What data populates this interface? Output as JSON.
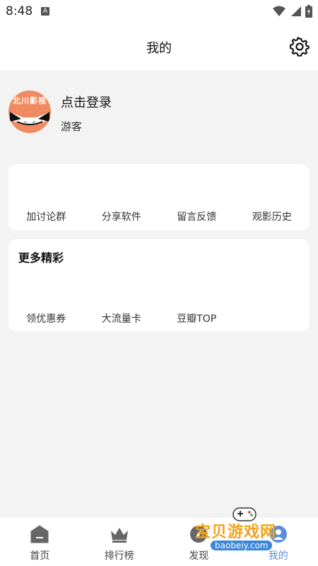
{
  "status_bar": {
    "time": "8:48",
    "a_badge": "A"
  },
  "header": {
    "title": "我的"
  },
  "profile": {
    "avatar_text": "北川影视",
    "login_label": "点击登录",
    "user_type": "游客"
  },
  "quick_actions": [
    {
      "label": "加讨论群"
    },
    {
      "label": "分享软件"
    },
    {
      "label": "留言反馈"
    },
    {
      "label": "观影历史"
    }
  ],
  "more_section": {
    "title": "更多精彩",
    "items": [
      {
        "label": "领优惠券"
      },
      {
        "label": "大流量卡"
      },
      {
        "label": "豆瓣TOP"
      }
    ]
  },
  "tabs": [
    {
      "label": "首页",
      "icon": "home-icon"
    },
    {
      "label": "排行榜",
      "icon": "crown-icon"
    },
    {
      "label": "发现",
      "icon": "discover-icon"
    },
    {
      "label": "我的",
      "icon": "profile-icon",
      "active": true
    }
  ],
  "watermark": {
    "text": "宝贝游戏网",
    "url": "baobeiy.com"
  },
  "colors": {
    "accent": "#5b8ed8",
    "avatar_bg": "#f08a60",
    "background": "#f3f3f3"
  }
}
